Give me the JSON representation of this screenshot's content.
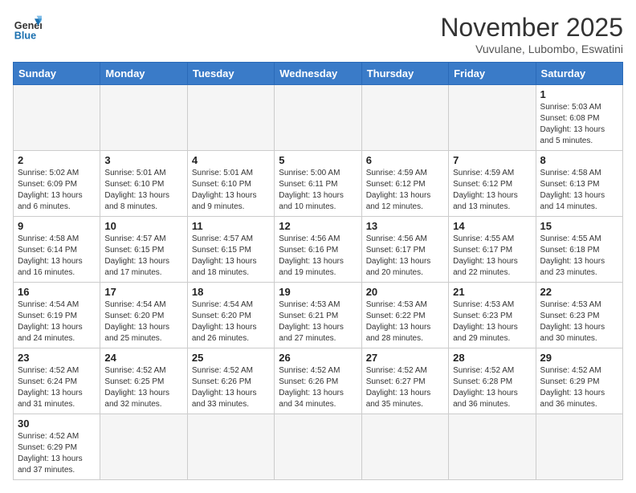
{
  "header": {
    "logo_line1": "General",
    "logo_line2": "Blue",
    "month": "November 2025",
    "location": "Vuvulane, Lubombo, Eswatini"
  },
  "weekdays": [
    "Sunday",
    "Monday",
    "Tuesday",
    "Wednesday",
    "Thursday",
    "Friday",
    "Saturday"
  ],
  "weeks": [
    [
      {
        "day": "",
        "info": ""
      },
      {
        "day": "",
        "info": ""
      },
      {
        "day": "",
        "info": ""
      },
      {
        "day": "",
        "info": ""
      },
      {
        "day": "",
        "info": ""
      },
      {
        "day": "",
        "info": ""
      },
      {
        "day": "1",
        "info": "Sunrise: 5:03 AM\nSunset: 6:08 PM\nDaylight: 13 hours and 5 minutes."
      }
    ],
    [
      {
        "day": "2",
        "info": "Sunrise: 5:02 AM\nSunset: 6:09 PM\nDaylight: 13 hours and 6 minutes."
      },
      {
        "day": "3",
        "info": "Sunrise: 5:01 AM\nSunset: 6:10 PM\nDaylight: 13 hours and 8 minutes."
      },
      {
        "day": "4",
        "info": "Sunrise: 5:01 AM\nSunset: 6:10 PM\nDaylight: 13 hours and 9 minutes."
      },
      {
        "day": "5",
        "info": "Sunrise: 5:00 AM\nSunset: 6:11 PM\nDaylight: 13 hours and 10 minutes."
      },
      {
        "day": "6",
        "info": "Sunrise: 4:59 AM\nSunset: 6:12 PM\nDaylight: 13 hours and 12 minutes."
      },
      {
        "day": "7",
        "info": "Sunrise: 4:59 AM\nSunset: 6:12 PM\nDaylight: 13 hours and 13 minutes."
      },
      {
        "day": "8",
        "info": "Sunrise: 4:58 AM\nSunset: 6:13 PM\nDaylight: 13 hours and 14 minutes."
      }
    ],
    [
      {
        "day": "9",
        "info": "Sunrise: 4:58 AM\nSunset: 6:14 PM\nDaylight: 13 hours and 16 minutes."
      },
      {
        "day": "10",
        "info": "Sunrise: 4:57 AM\nSunset: 6:15 PM\nDaylight: 13 hours and 17 minutes."
      },
      {
        "day": "11",
        "info": "Sunrise: 4:57 AM\nSunset: 6:15 PM\nDaylight: 13 hours and 18 minutes."
      },
      {
        "day": "12",
        "info": "Sunrise: 4:56 AM\nSunset: 6:16 PM\nDaylight: 13 hours and 19 minutes."
      },
      {
        "day": "13",
        "info": "Sunrise: 4:56 AM\nSunset: 6:17 PM\nDaylight: 13 hours and 20 minutes."
      },
      {
        "day": "14",
        "info": "Sunrise: 4:55 AM\nSunset: 6:17 PM\nDaylight: 13 hours and 22 minutes."
      },
      {
        "day": "15",
        "info": "Sunrise: 4:55 AM\nSunset: 6:18 PM\nDaylight: 13 hours and 23 minutes."
      }
    ],
    [
      {
        "day": "16",
        "info": "Sunrise: 4:54 AM\nSunset: 6:19 PM\nDaylight: 13 hours and 24 minutes."
      },
      {
        "day": "17",
        "info": "Sunrise: 4:54 AM\nSunset: 6:20 PM\nDaylight: 13 hours and 25 minutes."
      },
      {
        "day": "18",
        "info": "Sunrise: 4:54 AM\nSunset: 6:20 PM\nDaylight: 13 hours and 26 minutes."
      },
      {
        "day": "19",
        "info": "Sunrise: 4:53 AM\nSunset: 6:21 PM\nDaylight: 13 hours and 27 minutes."
      },
      {
        "day": "20",
        "info": "Sunrise: 4:53 AM\nSunset: 6:22 PM\nDaylight: 13 hours and 28 minutes."
      },
      {
        "day": "21",
        "info": "Sunrise: 4:53 AM\nSunset: 6:23 PM\nDaylight: 13 hours and 29 minutes."
      },
      {
        "day": "22",
        "info": "Sunrise: 4:53 AM\nSunset: 6:23 PM\nDaylight: 13 hours and 30 minutes."
      }
    ],
    [
      {
        "day": "23",
        "info": "Sunrise: 4:52 AM\nSunset: 6:24 PM\nDaylight: 13 hours and 31 minutes."
      },
      {
        "day": "24",
        "info": "Sunrise: 4:52 AM\nSunset: 6:25 PM\nDaylight: 13 hours and 32 minutes."
      },
      {
        "day": "25",
        "info": "Sunrise: 4:52 AM\nSunset: 6:26 PM\nDaylight: 13 hours and 33 minutes."
      },
      {
        "day": "26",
        "info": "Sunrise: 4:52 AM\nSunset: 6:26 PM\nDaylight: 13 hours and 34 minutes."
      },
      {
        "day": "27",
        "info": "Sunrise: 4:52 AM\nSunset: 6:27 PM\nDaylight: 13 hours and 35 minutes."
      },
      {
        "day": "28",
        "info": "Sunrise: 4:52 AM\nSunset: 6:28 PM\nDaylight: 13 hours and 36 minutes."
      },
      {
        "day": "29",
        "info": "Sunrise: 4:52 AM\nSunset: 6:29 PM\nDaylight: 13 hours and 36 minutes."
      }
    ],
    [
      {
        "day": "30",
        "info": "Sunrise: 4:52 AM\nSunset: 6:29 PM\nDaylight: 13 hours and 37 minutes."
      },
      {
        "day": "",
        "info": ""
      },
      {
        "day": "",
        "info": ""
      },
      {
        "day": "",
        "info": ""
      },
      {
        "day": "",
        "info": ""
      },
      {
        "day": "",
        "info": ""
      },
      {
        "day": "",
        "info": ""
      }
    ]
  ]
}
